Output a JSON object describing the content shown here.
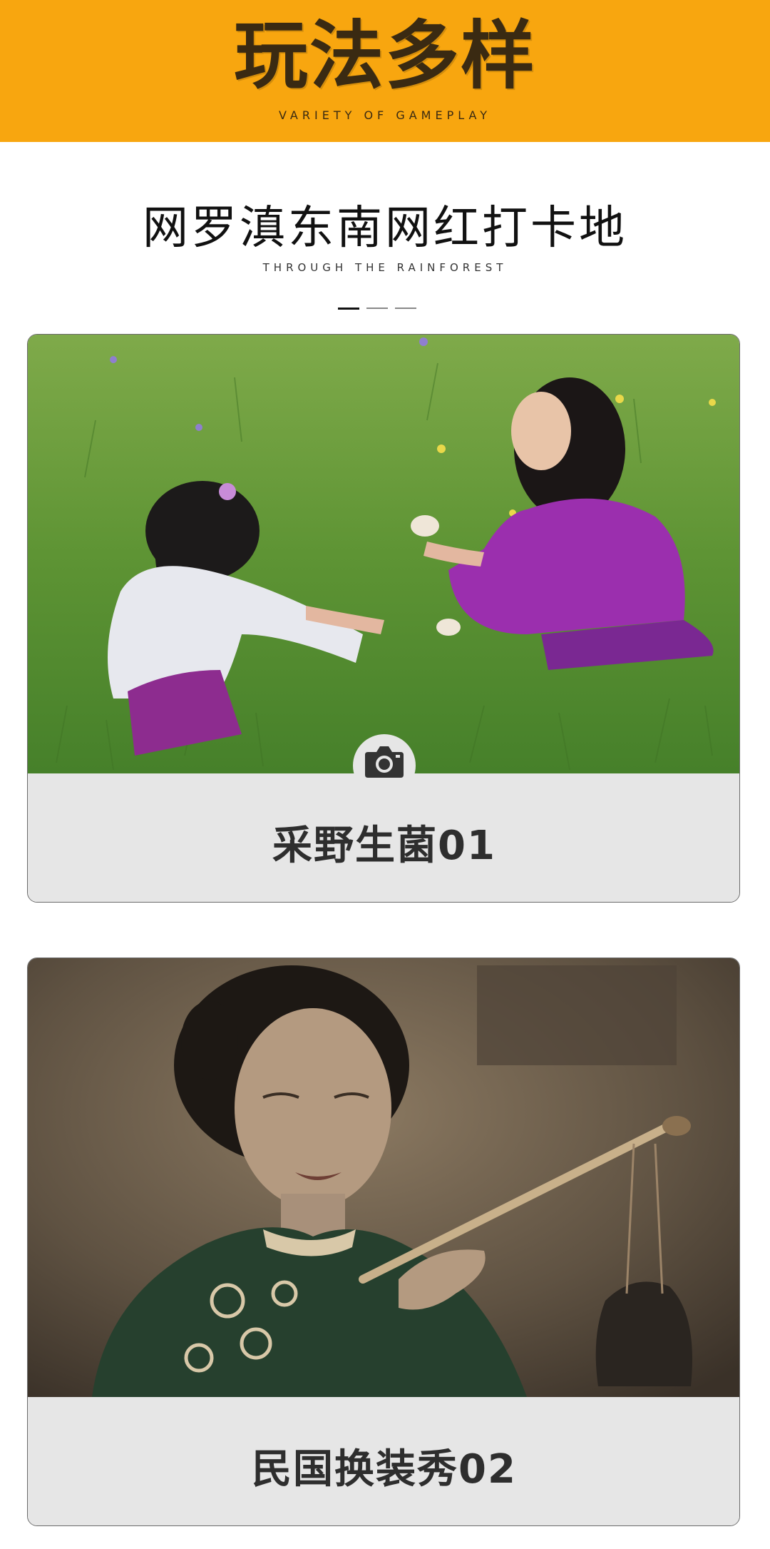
{
  "banner": {
    "title": "玩法多样",
    "subtitle": "VARIETY OF GAMEPLAY",
    "bg_color": "#f8a60f"
  },
  "section": {
    "title": "网罗滇东南网红打卡地",
    "subtitle": "THROUGH THE RAINFOREST"
  },
  "cards": [
    {
      "caption": "采野生菌01",
      "image": "children-picking-mushrooms-photo",
      "badge_icon": "camera-icon"
    },
    {
      "caption": "民国换装秀02",
      "image": "woman-in-qipao-with-pipe-photo"
    }
  ]
}
